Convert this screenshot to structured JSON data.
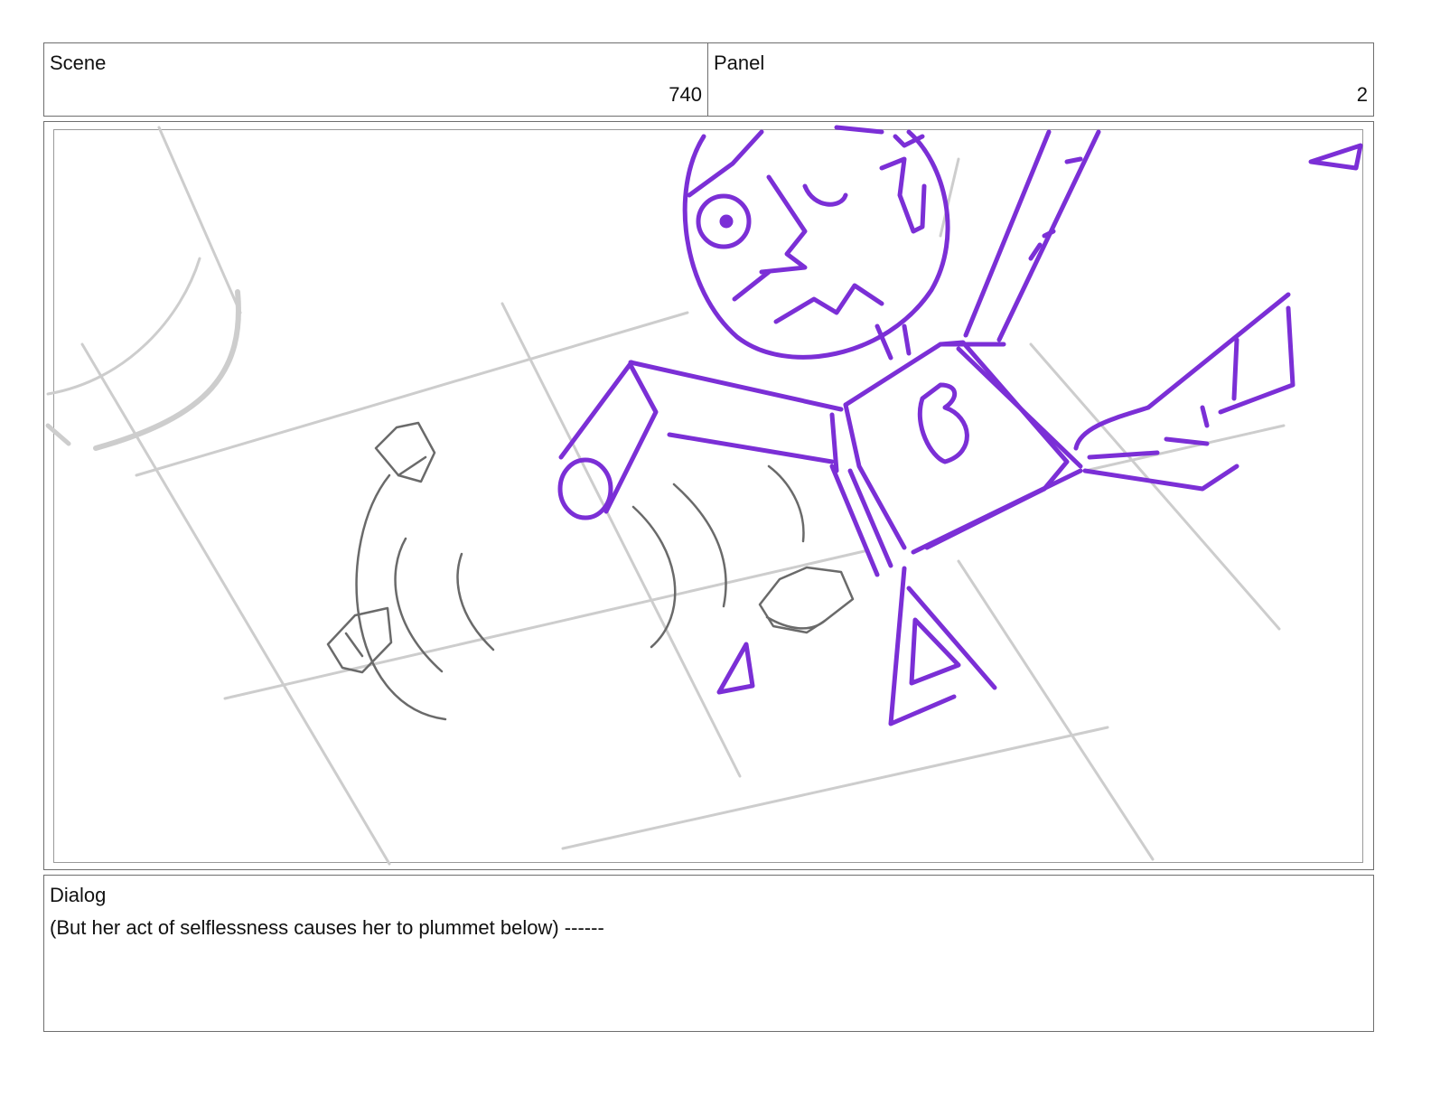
{
  "scene": {
    "label": "Scene",
    "value": "740"
  },
  "panel": {
    "label": "Panel",
    "value": "2"
  },
  "dialog": {
    "label": "Dialog",
    "text": "(But her act of selflessness causes her to plummet below) ------"
  },
  "colors": {
    "sketch_purple": "#7b2fd6",
    "pencil_grey": "#c8c8c8",
    "debris_grey": "#6a6a6a",
    "border": "#6e6e6e"
  }
}
